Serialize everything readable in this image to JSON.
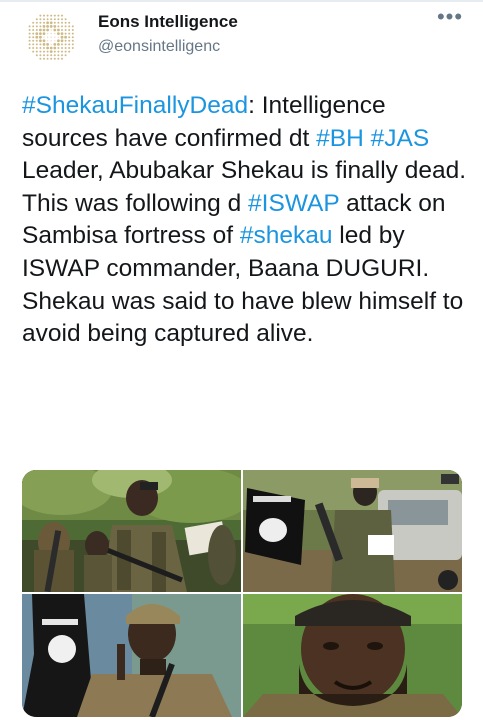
{
  "tweet": {
    "author": {
      "display_name": "Eons Intelligence",
      "handle": "@eonsintelligenc",
      "avatar_icon": "dotted-logo-avatar"
    },
    "more_icon": "more-options-icon",
    "text_segments": [
      {
        "text": "#ShekauFinallyDead",
        "type": "hashtag"
      },
      {
        "text": ": Intelligence sources have confirmed dt ",
        "type": "text"
      },
      {
        "text": "#BH",
        "type": "hashtag"
      },
      {
        "text": " ",
        "type": "text"
      },
      {
        "text": "#JAS",
        "type": "hashtag"
      },
      {
        "text": " Leader, Abubakar Shekau is finally dead. This was following d ",
        "type": "text"
      },
      {
        "text": "#ISWAP",
        "type": "hashtag"
      },
      {
        "text": " attack on Sambisa fortress of ",
        "type": "text"
      },
      {
        "text": "#shekau",
        "type": "hashtag"
      },
      {
        "text": " led by ISWAP commander, Baana DUGURI. Shekau was said to have blew himself to avoid being captured alive.",
        "type": "text"
      }
    ],
    "media": [
      {
        "name": "media-photo-1"
      },
      {
        "name": "media-photo-2"
      },
      {
        "name": "media-photo-3"
      },
      {
        "name": "media-photo-4"
      }
    ]
  },
  "colors": {
    "hashtag": "#1b95e0",
    "text": "#14171a",
    "secondary": "#657786",
    "logo_gold": "#c9b27a"
  }
}
